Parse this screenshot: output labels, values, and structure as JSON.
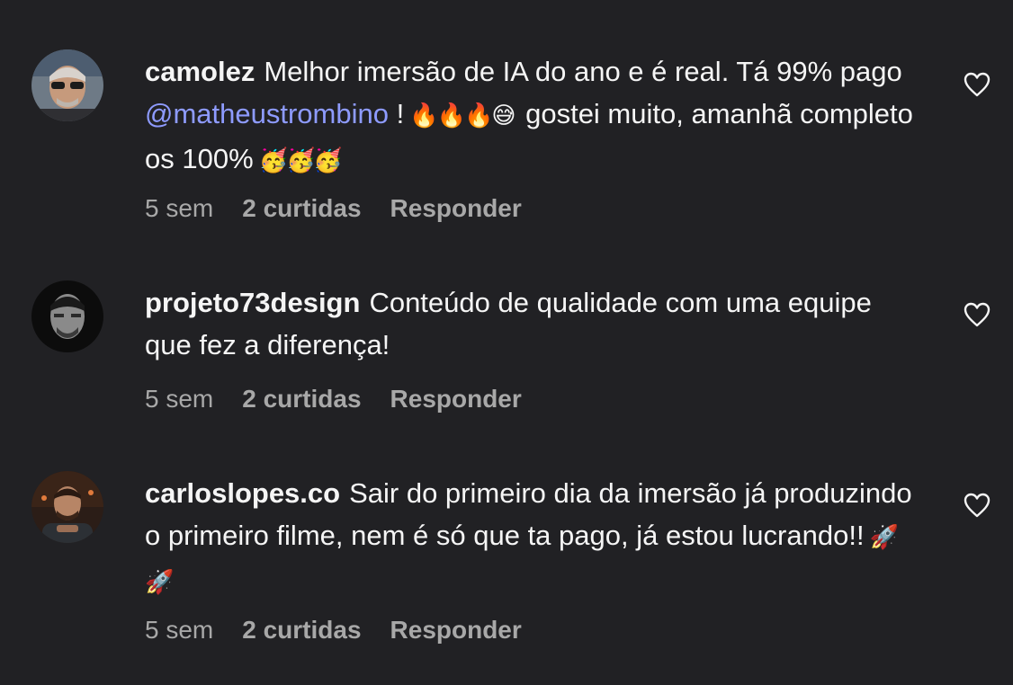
{
  "comments": [
    {
      "username": "camolez",
      "text_before": "Melhor imersão de IA do ano e é real. Tá 99% pago",
      "mention": "@matheustrombino",
      "text_after_mention": "!",
      "emojis_1": "🔥🔥🔥😅",
      "text_after_emojis": "gostei muito, amanhã completo os 100%",
      "emojis_2": "🥳🥳🥳",
      "time": "5 sem",
      "likes": "2 curtidas",
      "reply": "Responder"
    },
    {
      "username": "projeto73design",
      "text": "Conteúdo de qualidade com uma equipe que fez a diferença!",
      "time": "5 sem",
      "likes": "2 curtidas",
      "reply": "Responder"
    },
    {
      "username": "carloslopes.co",
      "text": "Sair do primeiro dia da imersão já produzindo o primeiro filme, nem é só que ta pago, já estou lucrando!!",
      "emojis": "🚀🚀",
      "time": "5 sem",
      "likes": "2 curtidas",
      "reply": "Responder"
    }
  ],
  "icons": {
    "like": "heart-outline-icon"
  },
  "colors": {
    "background": "#212124",
    "text": "#f5f5f5",
    "meta": "#a8a8a8",
    "mention": "#8e9bff"
  }
}
